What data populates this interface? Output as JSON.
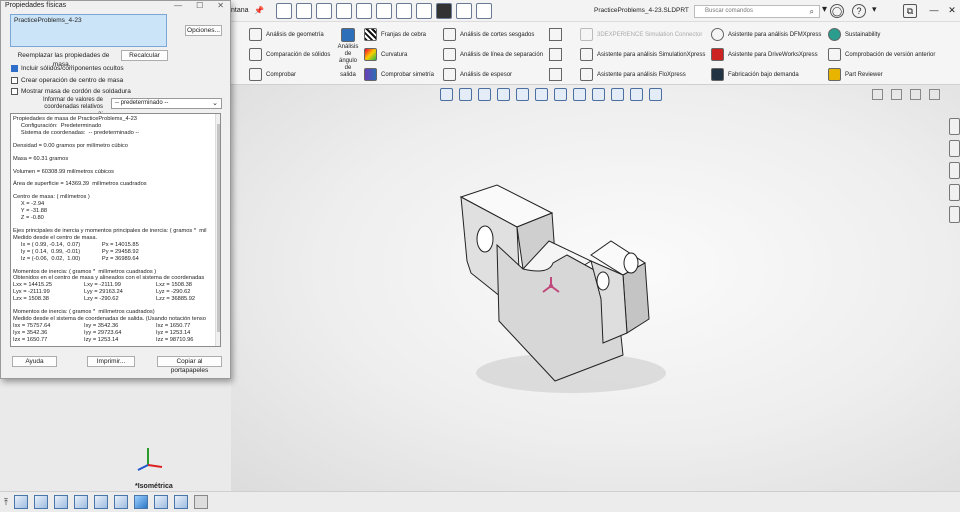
{
  "window": {
    "menu_fragment": "ntana",
    "file_name": "PracticeProblems_4-23.SLDPRT",
    "search_placeholder": "Buscar comandos"
  },
  "ribbon": {
    "items": [
      {
        "id": "geom",
        "label": "Análisis de geometría"
      },
      {
        "id": "solid",
        "label": "Comparación de sólidos"
      },
      {
        "id": "check",
        "label": "Comprobar"
      },
      {
        "id": "zebra",
        "label": "Franjas de cebra"
      },
      {
        "id": "curv",
        "label": "Curvatura"
      },
      {
        "id": "sym",
        "label": "Comprobar simetría"
      },
      {
        "id": "undercut",
        "label": "Análisis de cortes sesgados"
      },
      {
        "id": "parting",
        "label": "Análisis de línea de separación"
      },
      {
        "id": "thick",
        "label": "Análisis de espesor"
      },
      {
        "id": "sim3dx",
        "label": "3DEXPERIENCE Simulation Connector"
      },
      {
        "id": "simx",
        "label": "Asistente para análisis SimulationXpress"
      },
      {
        "id": "flox",
        "label": "Asistente para análisis FloXpress"
      },
      {
        "id": "dfm",
        "label": "Asistente para análisis DFMXpress"
      },
      {
        "id": "drive",
        "label": "Asistente para DriveWorksXpress"
      },
      {
        "id": "cost",
        "label": "Fabricación bajo demanda"
      },
      {
        "id": "sus",
        "label": "Sustainability"
      },
      {
        "id": "ver",
        "label": "Comprobación de versión anterior"
      },
      {
        "id": "rev",
        "label": "Part Reviewer"
      }
    ],
    "draft_label": "Análisis\nde\nángulo\nde\nsalida"
  },
  "dialog": {
    "title": "Propiedades físicas",
    "selection": "PracticeProblems_4-23",
    "options_btn": "Opciones...",
    "override_btn": "Reemplazar las propiedades de masa...",
    "recalc_btn": "Recalcular",
    "chk_hidden": "Incluir sólidos/componentes ocultos",
    "chk_center": "Crear operación de centro de masa",
    "chk_weld": "Mostrar masa de cordón de soldadura",
    "rel_label": "Informar de valores de coordenadas relativos a:",
    "rel_value": "-- predeterminado --",
    "help_btn": "Ayuda",
    "print_btn": "Imprimir...",
    "copy_btn": "Copiar al portapapeles",
    "hidden_checked": true,
    "center_checked": false,
    "weld_checked": false
  },
  "report": {
    "head1": "Propiedades de masa de PracticeProblems_4-23",
    "head2": "     Configuración:  Predeterminado",
    "head3": "     Sistema de coordenadas:  -- predeterminado --",
    "density": "Densidad = 0.00 gramos por milímetro cúbico",
    "mass": "Masa = 60.31 gramos",
    "volume": "Volumen = 60308.99 milímetros cúbicos",
    "area": "Área de superficie = 14369.39  milímetros cuadrados",
    "com_title": "Centro de masa: ( milímetros )",
    "com_x": "     X = -2.94",
    "com_y": "     Y = -31.88",
    "com_z": "     Z = -0.80",
    "axes_title": "Ejes principales de inercia y momentos principales de inercia: ( gramos *  mil",
    "axes_sub": "Medido desde el centro de masa.",
    "ix_a": "     Ix = ( 0.99, -0.14,  0.07)",
    "ix_b": "     Px = 14015.85",
    "iy_a": "     Iy = ( 0.14,  0.99, -0.01)",
    "iy_b": "     Py = 29458.92",
    "iz_a": "     Iz = (-0.06,  0.02,  1.00)",
    "iz_b": "     Pz = 36989.64",
    "m1_title": "Momentos de inercia: ( gramos *  milímetros cuadrados )",
    "m1_sub": "Obtenidos en el centro de masa y alineados con el sistema de coordenadas",
    "m1": [
      [
        "Lxx = 14415.25",
        "Lxy = -2111.99",
        "Lxz = 1508.38"
      ],
      [
        "Lyx = -2111.99",
        "Lyy = 29163.24",
        "Lyz = -290.62"
      ],
      [
        "Lzx = 1508.38",
        "Lzy = -290.62",
        "Lzz = 36885.92"
      ]
    ],
    "m2_title": "Momentos de inercia: ( gramos *  milímetros cuadrados)",
    "m2_sub": "Medido desde el sistema de coordenadas de salida. (Usando notación tenso",
    "m2": [
      [
        "Ixx = 75757.64",
        "Ixy = 3542.36",
        "Ixz = 1650.77"
      ],
      [
        "Iyx = 3542.36",
        "Iyy = 29723.64",
        "Iyz = 1253.14"
      ],
      [
        "Izx = 1650.77",
        "Izy = 1253.14",
        "Izz = 98710.96"
      ]
    ]
  },
  "viewport": {
    "view_name": "*Isométrica"
  }
}
